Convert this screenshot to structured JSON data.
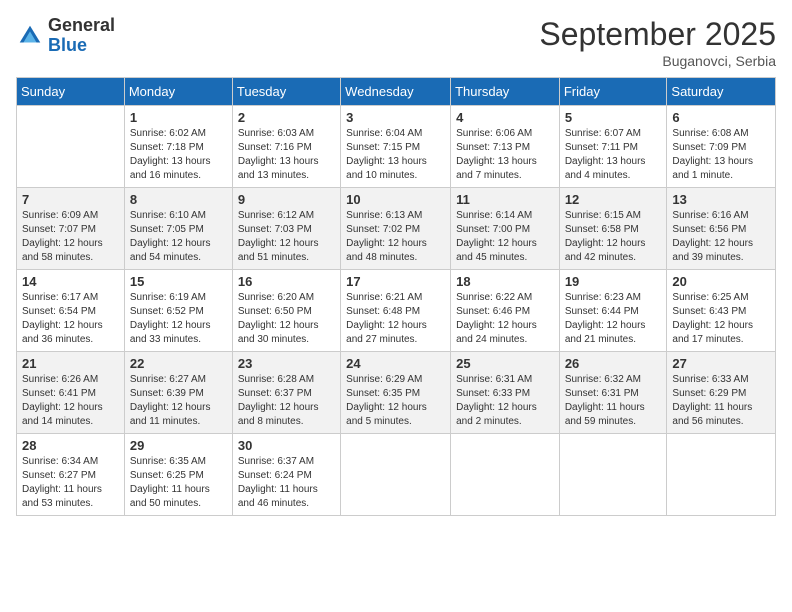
{
  "logo": {
    "general": "General",
    "blue": "Blue"
  },
  "title": "September 2025",
  "subtitle": "Buganovci, Serbia",
  "days_of_week": [
    "Sunday",
    "Monday",
    "Tuesday",
    "Wednesday",
    "Thursday",
    "Friday",
    "Saturday"
  ],
  "weeks": [
    [
      {
        "day": "",
        "sunrise": "",
        "sunset": "",
        "daylight": ""
      },
      {
        "day": "1",
        "sunrise": "Sunrise: 6:02 AM",
        "sunset": "Sunset: 7:18 PM",
        "daylight": "Daylight: 13 hours and 16 minutes."
      },
      {
        "day": "2",
        "sunrise": "Sunrise: 6:03 AM",
        "sunset": "Sunset: 7:16 PM",
        "daylight": "Daylight: 13 hours and 13 minutes."
      },
      {
        "day": "3",
        "sunrise": "Sunrise: 6:04 AM",
        "sunset": "Sunset: 7:15 PM",
        "daylight": "Daylight: 13 hours and 10 minutes."
      },
      {
        "day": "4",
        "sunrise": "Sunrise: 6:06 AM",
        "sunset": "Sunset: 7:13 PM",
        "daylight": "Daylight: 13 hours and 7 minutes."
      },
      {
        "day": "5",
        "sunrise": "Sunrise: 6:07 AM",
        "sunset": "Sunset: 7:11 PM",
        "daylight": "Daylight: 13 hours and 4 minutes."
      },
      {
        "day": "6",
        "sunrise": "Sunrise: 6:08 AM",
        "sunset": "Sunset: 7:09 PM",
        "daylight": "Daylight: 13 hours and 1 minute."
      }
    ],
    [
      {
        "day": "7",
        "sunrise": "Sunrise: 6:09 AM",
        "sunset": "Sunset: 7:07 PM",
        "daylight": "Daylight: 12 hours and 58 minutes."
      },
      {
        "day": "8",
        "sunrise": "Sunrise: 6:10 AM",
        "sunset": "Sunset: 7:05 PM",
        "daylight": "Daylight: 12 hours and 54 minutes."
      },
      {
        "day": "9",
        "sunrise": "Sunrise: 6:12 AM",
        "sunset": "Sunset: 7:03 PM",
        "daylight": "Daylight: 12 hours and 51 minutes."
      },
      {
        "day": "10",
        "sunrise": "Sunrise: 6:13 AM",
        "sunset": "Sunset: 7:02 PM",
        "daylight": "Daylight: 12 hours and 48 minutes."
      },
      {
        "day": "11",
        "sunrise": "Sunrise: 6:14 AM",
        "sunset": "Sunset: 7:00 PM",
        "daylight": "Daylight: 12 hours and 45 minutes."
      },
      {
        "day": "12",
        "sunrise": "Sunrise: 6:15 AM",
        "sunset": "Sunset: 6:58 PM",
        "daylight": "Daylight: 12 hours and 42 minutes."
      },
      {
        "day": "13",
        "sunrise": "Sunrise: 6:16 AM",
        "sunset": "Sunset: 6:56 PM",
        "daylight": "Daylight: 12 hours and 39 minutes."
      }
    ],
    [
      {
        "day": "14",
        "sunrise": "Sunrise: 6:17 AM",
        "sunset": "Sunset: 6:54 PM",
        "daylight": "Daylight: 12 hours and 36 minutes."
      },
      {
        "day": "15",
        "sunrise": "Sunrise: 6:19 AM",
        "sunset": "Sunset: 6:52 PM",
        "daylight": "Daylight: 12 hours and 33 minutes."
      },
      {
        "day": "16",
        "sunrise": "Sunrise: 6:20 AM",
        "sunset": "Sunset: 6:50 PM",
        "daylight": "Daylight: 12 hours and 30 minutes."
      },
      {
        "day": "17",
        "sunrise": "Sunrise: 6:21 AM",
        "sunset": "Sunset: 6:48 PM",
        "daylight": "Daylight: 12 hours and 27 minutes."
      },
      {
        "day": "18",
        "sunrise": "Sunrise: 6:22 AM",
        "sunset": "Sunset: 6:46 PM",
        "daylight": "Daylight: 12 hours and 24 minutes."
      },
      {
        "day": "19",
        "sunrise": "Sunrise: 6:23 AM",
        "sunset": "Sunset: 6:44 PM",
        "daylight": "Daylight: 12 hours and 21 minutes."
      },
      {
        "day": "20",
        "sunrise": "Sunrise: 6:25 AM",
        "sunset": "Sunset: 6:43 PM",
        "daylight": "Daylight: 12 hours and 17 minutes."
      }
    ],
    [
      {
        "day": "21",
        "sunrise": "Sunrise: 6:26 AM",
        "sunset": "Sunset: 6:41 PM",
        "daylight": "Daylight: 12 hours and 14 minutes."
      },
      {
        "day": "22",
        "sunrise": "Sunrise: 6:27 AM",
        "sunset": "Sunset: 6:39 PM",
        "daylight": "Daylight: 12 hours and 11 minutes."
      },
      {
        "day": "23",
        "sunrise": "Sunrise: 6:28 AM",
        "sunset": "Sunset: 6:37 PM",
        "daylight": "Daylight: 12 hours and 8 minutes."
      },
      {
        "day": "24",
        "sunrise": "Sunrise: 6:29 AM",
        "sunset": "Sunset: 6:35 PM",
        "daylight": "Daylight: 12 hours and 5 minutes."
      },
      {
        "day": "25",
        "sunrise": "Sunrise: 6:31 AM",
        "sunset": "Sunset: 6:33 PM",
        "daylight": "Daylight: 12 hours and 2 minutes."
      },
      {
        "day": "26",
        "sunrise": "Sunrise: 6:32 AM",
        "sunset": "Sunset: 6:31 PM",
        "daylight": "Daylight: 11 hours and 59 minutes."
      },
      {
        "day": "27",
        "sunrise": "Sunrise: 6:33 AM",
        "sunset": "Sunset: 6:29 PM",
        "daylight": "Daylight: 11 hours and 56 minutes."
      }
    ],
    [
      {
        "day": "28",
        "sunrise": "Sunrise: 6:34 AM",
        "sunset": "Sunset: 6:27 PM",
        "daylight": "Daylight: 11 hours and 53 minutes."
      },
      {
        "day": "29",
        "sunrise": "Sunrise: 6:35 AM",
        "sunset": "Sunset: 6:25 PM",
        "daylight": "Daylight: 11 hours and 50 minutes."
      },
      {
        "day": "30",
        "sunrise": "Sunrise: 6:37 AM",
        "sunset": "Sunset: 6:24 PM",
        "daylight": "Daylight: 11 hours and 46 minutes."
      },
      {
        "day": "",
        "sunrise": "",
        "sunset": "",
        "daylight": ""
      },
      {
        "day": "",
        "sunrise": "",
        "sunset": "",
        "daylight": ""
      },
      {
        "day": "",
        "sunrise": "",
        "sunset": "",
        "daylight": ""
      },
      {
        "day": "",
        "sunrise": "",
        "sunset": "",
        "daylight": ""
      }
    ]
  ]
}
